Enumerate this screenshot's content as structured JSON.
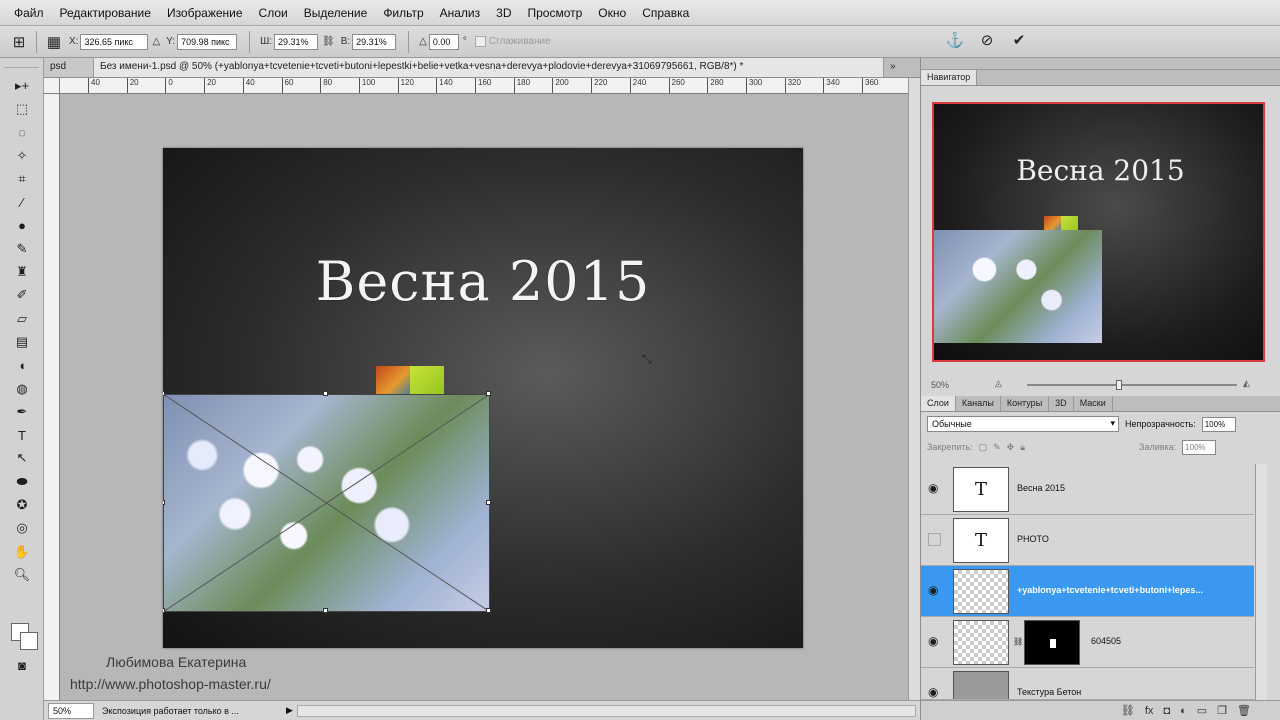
{
  "menu": [
    "Файл",
    "Редактирование",
    "Изображение",
    "Слои",
    "Выделение",
    "Фильтр",
    "Анализ",
    "3D",
    "Просмотр",
    "Окно",
    "Справка"
  ],
  "options": {
    "x_label": "X:",
    "x_value": "326.65 пикс",
    "y_label": "Y:",
    "y_value": "709.98 пикс",
    "w_label": "Ш:",
    "w_value": "29.31%",
    "h_label": "В:",
    "h_value": "29.31%",
    "angle_label": "△",
    "angle_value": "0.00",
    "angle_unit": "°",
    "smoothing_label": "Сглаживание"
  },
  "doc_tabs": {
    "prev_tab": "psd",
    "active_tab": "Без имени-1.psd @ 50% (+yablonya+tcvetenie+tcveti+butoni+lepestki+belie+vetka+vesna+derevya+plodovie+derevya+31069795661, RGB/8*) *"
  },
  "ruler_ticks": [
    "40",
    "20",
    "0",
    "20",
    "40",
    "60",
    "80",
    "100",
    "120",
    "140",
    "160",
    "180",
    "200",
    "220",
    "240",
    "260",
    "280",
    "300",
    "320",
    "340",
    "360"
  ],
  "canvas": {
    "title": "Весна 2015"
  },
  "watermark": {
    "author": "Любимова Екатерина",
    "url": "http://www.photoshop-master.ru/"
  },
  "status": {
    "zoom": "50%",
    "info": "Экспозиция работает только в ..."
  },
  "navigator": {
    "title": "Навигатор",
    "preview_title": "Весна 2015",
    "zoom": "50%",
    "zoom_fraction": 0.44
  },
  "layers_panel": {
    "tabs": [
      "Слои",
      "Каналы",
      "Контуры",
      "3D",
      "Маски"
    ],
    "blend_mode": "Обычные",
    "opacity_label": "Непрозрачность:",
    "opacity_value": "100%",
    "lock_label": "Закрепить:",
    "fill_label": "Заливка:",
    "fill_value": "100%",
    "layers": [
      {
        "name": "Весна 2015",
        "type": "text",
        "visible": true,
        "thumb": "T"
      },
      {
        "name": "PHOTO",
        "type": "text",
        "visible": false,
        "thumb": "T"
      },
      {
        "name": "+yablonya+tcvetenie+tcveti+butoni+lepes...",
        "type": "image",
        "visible": true,
        "selected": true
      },
      {
        "name": "604505",
        "type": "masked",
        "visible": true
      },
      {
        "name": "Текстура Бетон",
        "type": "image",
        "visible": true
      }
    ]
  },
  "colors": {
    "selection_blue": "#3b98f0",
    "nav_frame_red": "#d9393f"
  }
}
